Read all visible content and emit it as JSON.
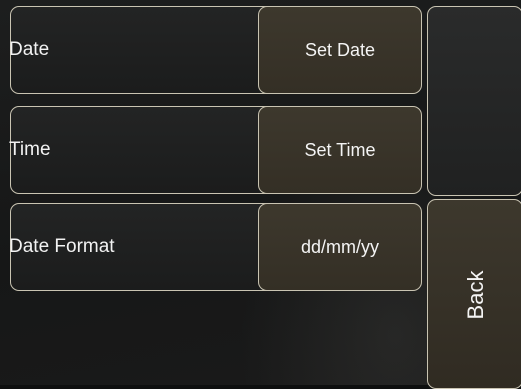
{
  "rows": [
    {
      "label": "Date",
      "button_label": "Set Date"
    },
    {
      "label": "Time",
      "button_label": "Set Time"
    },
    {
      "label": "Date Format",
      "button_label": "dd/mm/yy"
    }
  ],
  "side": {
    "top_button_label": "",
    "back_label": "Back"
  },
  "colors": {
    "border": "#c9c4b2",
    "button_fill": "#3a3529",
    "panel_fill": "#1f2020",
    "background": "#161717",
    "text": "#f2f2f2"
  }
}
